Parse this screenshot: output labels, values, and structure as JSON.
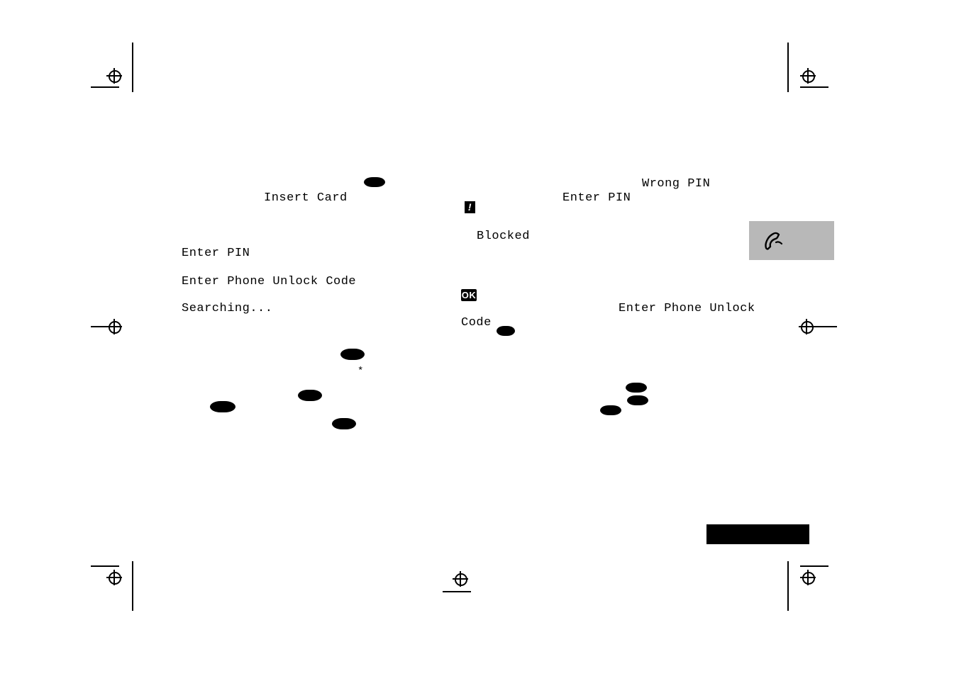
{
  "labels": {
    "insert_card": "Insert Card",
    "enter_pin_left": "Enter PIN",
    "enter_unlock_left": "Enter Phone Unlock Code",
    "searching": "Searching...",
    "blocked": "Blocked",
    "code": "Code",
    "wrong_pin": "Wrong PIN",
    "enter_pin_right": "Enter PIN",
    "enter_unlock_right": "Enter Phone Unlock",
    "ok": "OK",
    "bang": "!",
    "asterisk": "*"
  }
}
